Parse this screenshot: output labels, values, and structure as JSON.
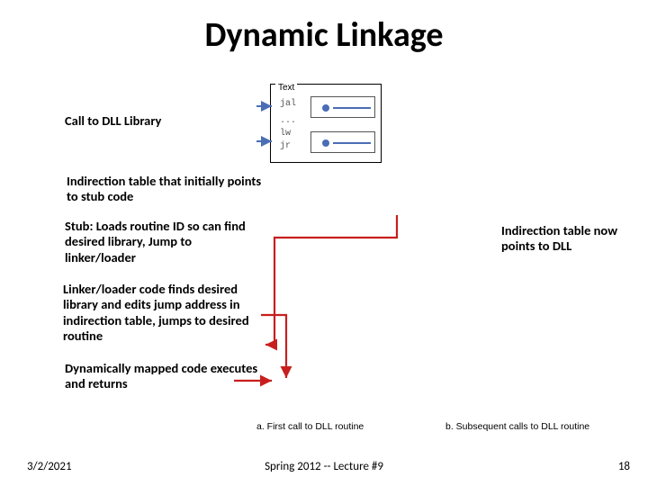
{
  "title": "Dynamic Linkage",
  "labels": {
    "call": "Call to DLL Library",
    "indirection": "Indirection table that initially points to stub code",
    "stub": "Stub: Loads routine ID so can find desired library, Jump to linker/loader",
    "linker": "Linker/loader code finds desired library and edits jump address in indirection table, jumps to desired routine",
    "dynamic": "Dynamically mapped code executes and returns",
    "right": "Indirection table now points to DLL"
  },
  "codebox": {
    "header": "Text",
    "l1": "jal",
    "l2": "...",
    "l3": "lw",
    "l4": "jr"
  },
  "captions": {
    "a": "a. First call to DLL routine",
    "b": "b. Subsequent calls to DLL routine"
  },
  "footer": {
    "date": "3/2/2021",
    "lecture": "Spring 2012 -- Lecture #9",
    "page": "18"
  }
}
